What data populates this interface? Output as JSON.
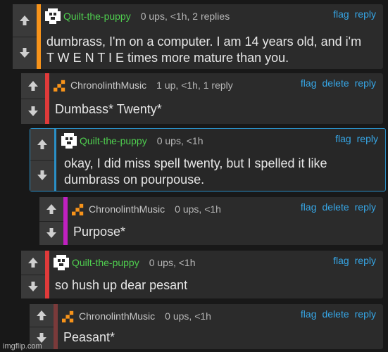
{
  "colors": {
    "bg": "#181818",
    "card": "#2b2b2b",
    "link": "#36a6e6",
    "user_green": "#4fcf4f",
    "accent_orange": "#f7931a",
    "accent_red": "#e03a3a",
    "accent_blue": "#2a8fc6",
    "accent_magenta": "#c020c0",
    "accent_dark_red": "#7a3a3a"
  },
  "comments": [
    {
      "user": "Quilt-the-puppy",
      "meta": "0 ups, <1h, 2 replies",
      "actions": [
        "flag",
        "reply"
      ],
      "text": "dumbrass, I'm on a computer. I am 14 years old, and i'm\nT W E N T I E times more mature than you."
    },
    {
      "user": "ChronolinthMusic",
      "meta": "1 up, <1h, 1 reply",
      "actions": [
        "flag",
        "delete",
        "reply"
      ],
      "text": "Dumbass* Twenty*"
    },
    {
      "user": "Quilt-the-puppy",
      "meta": "0 ups, <1h",
      "actions": [
        "flag",
        "reply"
      ],
      "text": "okay, I did miss spell twenty, but I spelled it like\ndumbrass on pourpouse."
    },
    {
      "user": "ChronolinthMusic",
      "meta": "0 ups, <1h",
      "actions": [
        "flag",
        "delete",
        "reply"
      ],
      "text": "Purpose*"
    },
    {
      "user": "Quilt-the-puppy",
      "meta": "0 ups, <1h",
      "actions": [
        "flag",
        "reply"
      ],
      "text": "so hush up dear pesant"
    },
    {
      "user": "ChronolinthMusic",
      "meta": "0 ups, <1h",
      "actions": [
        "flag",
        "delete",
        "reply"
      ],
      "text": "Peasant*"
    }
  ],
  "icons": {
    "upvote": "arrow-up-icon",
    "downvote": "arrow-down-icon",
    "avatar_dog": "pixel-dog-avatar-icon",
    "avatar_chronolinth": "pixel-orange-avatar-icon"
  },
  "watermark": "imgflip.com"
}
